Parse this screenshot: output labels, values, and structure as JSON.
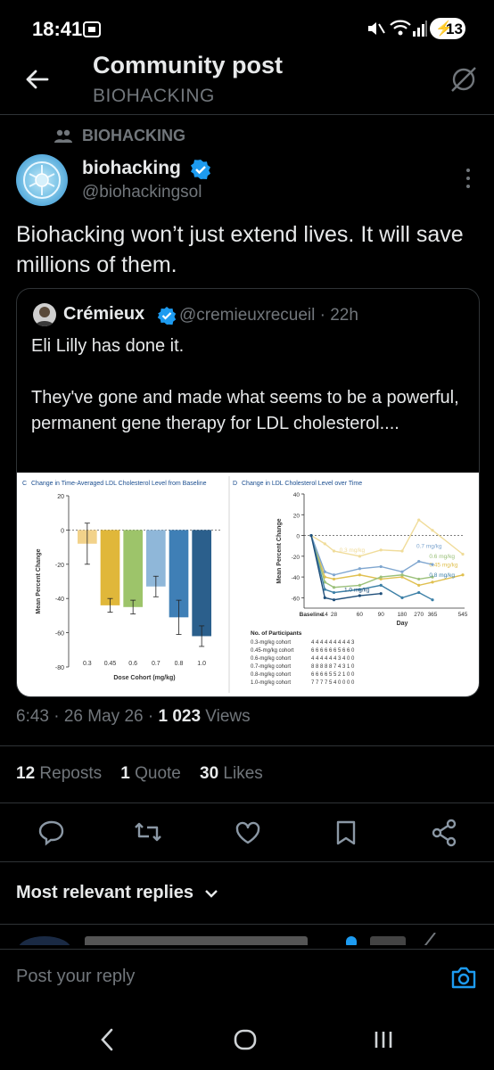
{
  "status_bar": {
    "time": "18:41",
    "battery": "13"
  },
  "header": {
    "title": "Community post",
    "subtitle": "BIOHACKING"
  },
  "post": {
    "community": "BIOHACKING",
    "author_name": "biohacking",
    "author_handle": "@biohackingsol",
    "text": "Biohacking won’t just extend lives. It will save millions of them.",
    "quote": {
      "author_name": "Crémieux",
      "author_handle": "@cremieuxrecueil · 22h",
      "text_line1": "Eli Lilly has done it.",
      "text_line2": "They've gone and made what seems to be a powerful, permanent gene therapy for LDL cholesterol...."
    },
    "time": "6:43 · 26 May 26 · ",
    "views_count": "1 023",
    "views_label": " Views",
    "reposts_count": "12",
    "reposts_label": " Reposts",
    "quotes_count": "1",
    "quotes_label": " Quote",
    "likes_count": "30",
    "likes_label": " Likes"
  },
  "replies": {
    "sort_label": "Most relevant replies"
  },
  "reply_bar": {
    "placeholder": "Post your reply"
  },
  "icons": {
    "back": "arrow-left-icon",
    "hide": "slash-circle-icon",
    "community": "people-icon",
    "more": "more-vertical-icon",
    "verified": "verified-badge-icon",
    "reply": "reply-icon",
    "repost": "repost-icon",
    "like": "heart-icon",
    "bookmark": "bookmark-icon",
    "share": "share-icon",
    "camera": "camera-icon"
  },
  "colors": {
    "accent": "#1d9bf0",
    "muted": "#71767b",
    "text": "#e7e9ea"
  },
  "chart_data": [
    {
      "type": "bar",
      "panel": "C",
      "title": "Change in Time-Averaged LDL Cholesterol Level from Baseline",
      "xlabel": "Dose Cohort (mg/kg)",
      "ylabel": "Mean Percent Change",
      "categories": [
        "0.3",
        "0.45",
        "0.6",
        "0.7",
        "0.8",
        "1.0"
      ],
      "values": [
        -8,
        -44,
        -45,
        -33,
        -51,
        -62
      ],
      "errors": [
        12,
        4,
        4,
        6,
        10,
        6
      ],
      "colors": [
        "#f2d28a",
        "#e0b73a",
        "#9dc46a",
        "#8fb7d9",
        "#3f7fb6",
        "#2b5f8c"
      ],
      "ylim": [
        -80,
        20
      ],
      "yticks": [
        "20",
        "0",
        "-20",
        "-40",
        "-60",
        "-80"
      ]
    },
    {
      "type": "line",
      "panel": "D",
      "title": "Change in LDL Cholesterol Level over Time",
      "xlabel": "Day",
      "ylabel": "Mean Percent Change",
      "x_ticks": [
        "Baseline",
        "14",
        "28",
        "60",
        "90",
        "180",
        "270",
        "365",
        "545"
      ],
      "ylim": [
        -70,
        40
      ],
      "yticks": [
        "40",
        "20",
        "0",
        "-20",
        "-40",
        "-60"
      ],
      "series": [
        {
          "name": "0.3 mg/kg",
          "color": "#f0dc9a",
          "values": [
            0,
            -8,
            -15,
            -20,
            -14,
            -15,
            15,
            5,
            -18
          ]
        },
        {
          "name": "0.45 mg/kg",
          "color": "#e0c050",
          "values": [
            0,
            -40,
            -42,
            -38,
            -42,
            -40,
            -48,
            -45,
            -38
          ]
        },
        {
          "name": "0.6 mg/kg",
          "color": "#9bc07a",
          "values": [
            0,
            -45,
            -50,
            -48,
            -40,
            -38,
            -42,
            -40,
            null
          ]
        },
        {
          "name": "0.7 mg/kg",
          "color": "#7fa6cf",
          "values": [
            0,
            -35,
            -38,
            -32,
            -30,
            -35,
            -25,
            -28,
            null
          ]
        },
        {
          "name": "0.8 mg/kg",
          "color": "#3b7fa6",
          "values": [
            0,
            -52,
            -55,
            -52,
            -48,
            -60,
            -55,
            -62,
            null
          ]
        },
        {
          "name": "1.0 mg/kg",
          "color": "#1f4f7a",
          "values": [
            0,
            -60,
            -62,
            -58,
            -56,
            null,
            null,
            null,
            null
          ]
        }
      ],
      "participants_title": "No. of Participants",
      "participants": [
        {
          "cohort": "0.3-mg/kg cohort",
          "counts": "4   4 4 4      4        4        4    4    4        3"
        },
        {
          "cohort": "0.45-mg/kg cohort",
          "counts": "6   6 6 6      6        6        5    6    6        0"
        },
        {
          "cohort": "0.6-mg/kg cohort",
          "counts": "4   4 4 4      4        4        3    4    0        0"
        },
        {
          "cohort": "0.7-mg/kg cohort",
          "counts": "8   8 8 8      8        7        4    3    1        0"
        },
        {
          "cohort": "0.8-mg/kg cohort",
          "counts": "6   6 6 6      5        5        2    1    0        0"
        },
        {
          "cohort": "1.0-mg/kg cohort",
          "counts": "7   7 7 7      5        4        0    0    0        0"
        }
      ]
    }
  ]
}
